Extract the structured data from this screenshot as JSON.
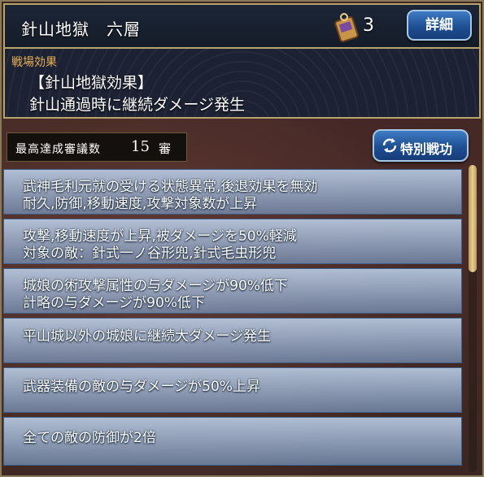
{
  "header": {
    "title": "針山地獄　六層",
    "item_count": "3",
    "detail_label": "詳細"
  },
  "battlefield": {
    "label": "戦場効果",
    "line1": "【針山地獄効果】",
    "line2": "針山通過時に継続ダメージ発生"
  },
  "record": {
    "label": "最高達成審議数",
    "value": "15",
    "unit": "審"
  },
  "special_button": {
    "label": "特別戦功"
  },
  "effects": [
    {
      "lines": [
        "武神毛利元就の受ける状態異常,後退効果を無効",
        "耐久,防御,移動速度,攻撃対象数が上昇"
      ]
    },
    {
      "lines": [
        "攻撃,移動速度が上昇,被ダメージを50%軽減",
        "対象の敵：針式一ノ谷形兜,針式毛虫形兜"
      ]
    },
    {
      "lines": [
        "城娘の術攻撃属性の与ダメージが90%低下",
        "計略の与ダメージが90%低下"
      ]
    },
    {
      "lines": [
        "平山城以外の城娘に継続大ダメージ発生"
      ]
    },
    {
      "lines": [
        "武器装備の敵の与ダメージが50%上昇"
      ]
    },
    {
      "lines": [
        "全ての敵の防御が2倍"
      ]
    }
  ],
  "colors": {
    "accent_gold": "#e8b054",
    "button_blue": "#1f4f93",
    "row_blue": "#a8c0de"
  },
  "icons": {
    "item": "talisman-item-icon",
    "refresh": "refresh-icon"
  }
}
